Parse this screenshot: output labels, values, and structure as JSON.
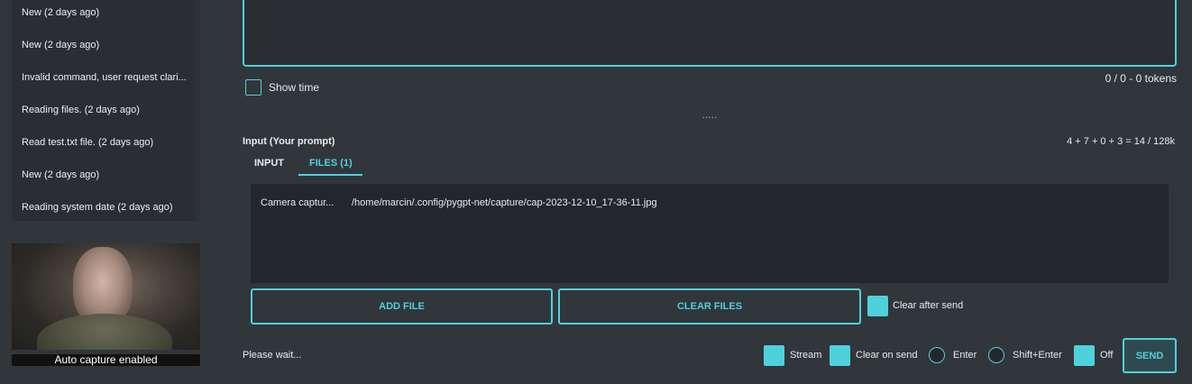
{
  "sidebar": {
    "contexts": [
      "New (2 days ago)",
      "New (2 days ago)",
      "Invalid command, user request clari...",
      "Reading files. (2 days ago)",
      "Read test.txt file. (2 days ago)",
      "New (2 days ago)",
      "Reading system date (2 days ago)"
    ],
    "camera_status": "Auto capture enabled"
  },
  "output": {
    "show_time_label": "Show time",
    "tokens": "0 / 0 - 0 tokens",
    "splitter": "....."
  },
  "input": {
    "title": "Input (Your prompt)",
    "token_calc": "4 + 7 + 0 + 3 = 14 / 128k",
    "tabs": [
      "INPUT",
      "FILES (1)"
    ],
    "files": [
      {
        "name": "Camera captur...",
        "path": "/home/marcin/.config/pygpt-net/capture/cap-2023-12-10_17-36-11.jpg"
      }
    ],
    "add_file_label": "ADD FILE",
    "clear_files_label": "CLEAR FILES",
    "clear_after_send_label": "Clear after send"
  },
  "footer": {
    "status": "Please wait...",
    "stream_label": "Stream",
    "clear_on_send_label": "Clear on send",
    "enter_label": "Enter",
    "shift_enter_label": "Shift+Enter",
    "off_label": "Off",
    "send_label": "SEND"
  },
  "colors": {
    "accent": "#4fd1dc",
    "background": "#31363b",
    "panel": "#2a2e32"
  }
}
